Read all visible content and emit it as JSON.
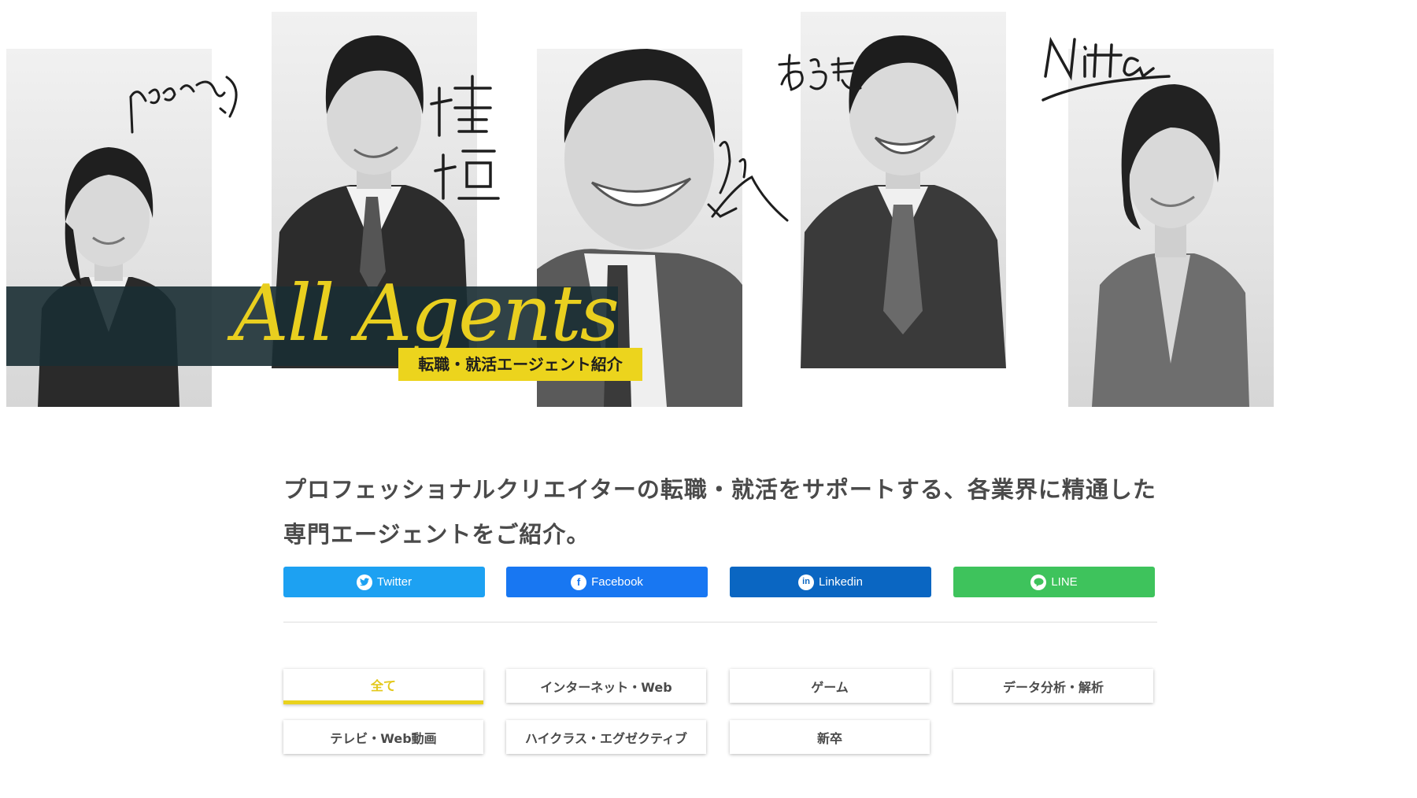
{
  "hero": {
    "title": "All Agents",
    "subtitle": "転職・就活エージェント紹介",
    "signatures": [
      "ふるかわ",
      "檜垣",
      "小",
      "あらき",
      "Nitta"
    ]
  },
  "intro": {
    "text": "プロフェッショナルクリエイターの転職・就活をサポートする、各業界に精通した専門エージェントをご紹介。"
  },
  "share": [
    {
      "label": "Twitter",
      "icon": "twitter-icon",
      "color": "#1da1f2"
    },
    {
      "label": "Facebook",
      "icon": "facebook-icon",
      "color": "#1877f2"
    },
    {
      "label": "Linkedin",
      "icon": "linkedin-icon",
      "color": "#0a66c2"
    },
    {
      "label": "LINE",
      "icon": "line-icon",
      "color": "#3ec35c"
    }
  ],
  "categories": [
    {
      "label": "全て",
      "active": true
    },
    {
      "label": "インターネット・Web",
      "active": false
    },
    {
      "label": "ゲーム",
      "active": false
    },
    {
      "label": "データ分析・解析",
      "active": false
    },
    {
      "label": "テレビ・Web動画",
      "active": false
    },
    {
      "label": "ハイクラス・エグゼクティブ",
      "active": false
    },
    {
      "label": "新卒",
      "active": false
    }
  ],
  "colors": {
    "accent": "#e9d21e",
    "band": "#1a2e33"
  }
}
